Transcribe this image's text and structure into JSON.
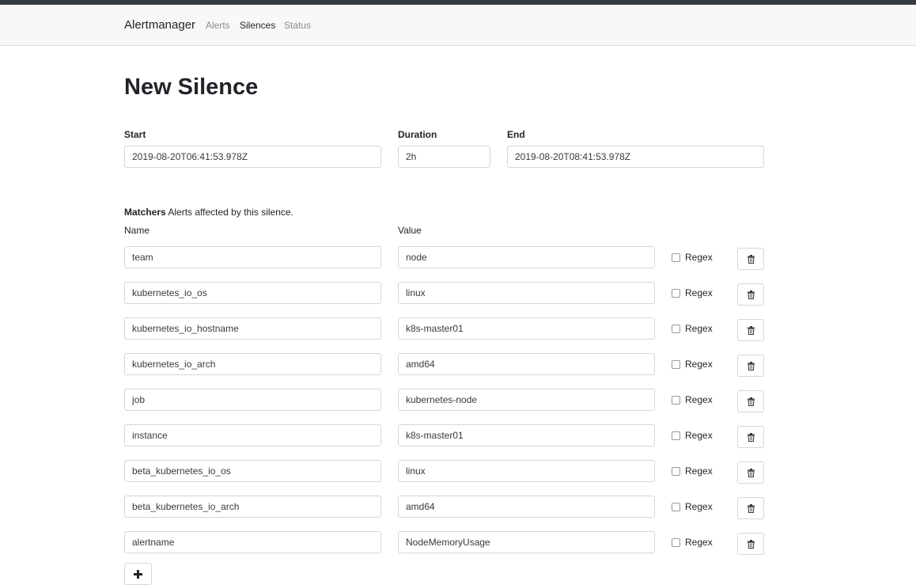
{
  "navbar": {
    "brand": "Alertmanager",
    "links": [
      {
        "label": "Alerts",
        "active": false
      },
      {
        "label": "Silences",
        "active": true
      },
      {
        "label": "Status",
        "active": false
      }
    ]
  },
  "page": {
    "title": "New Silence"
  },
  "form": {
    "start_label": "Start",
    "start_value": "2019-08-20T06:41:53.978Z",
    "duration_label": "Duration",
    "duration_value": "2h",
    "end_label": "End",
    "end_value": "2019-08-20T08:41:53.978Z"
  },
  "matchers": {
    "heading": "Matchers",
    "description": "Alerts affected by this silence.",
    "name_col": "Name",
    "value_col": "Value",
    "regex_label": "Regex",
    "delete_icon": "trash-icon",
    "add_icon": "plus-icon",
    "rows": [
      {
        "name": "team",
        "value": "node",
        "regex": false
      },
      {
        "name": "kubernetes_io_os",
        "value": "linux",
        "regex": false
      },
      {
        "name": "kubernetes_io_hostname",
        "value": "k8s-master01",
        "regex": false
      },
      {
        "name": "kubernetes_io_arch",
        "value": "amd64",
        "regex": false
      },
      {
        "name": "job",
        "value": "kubernetes-node",
        "regex": false
      },
      {
        "name": "instance",
        "value": "k8s-master01",
        "regex": false
      },
      {
        "name": "beta_kubernetes_io_os",
        "value": "linux",
        "regex": false
      },
      {
        "name": "beta_kubernetes_io_arch",
        "value": "amd64",
        "regex": false
      },
      {
        "name": "alertname",
        "value": "NodeMemoryUsage",
        "regex": false
      }
    ]
  }
}
